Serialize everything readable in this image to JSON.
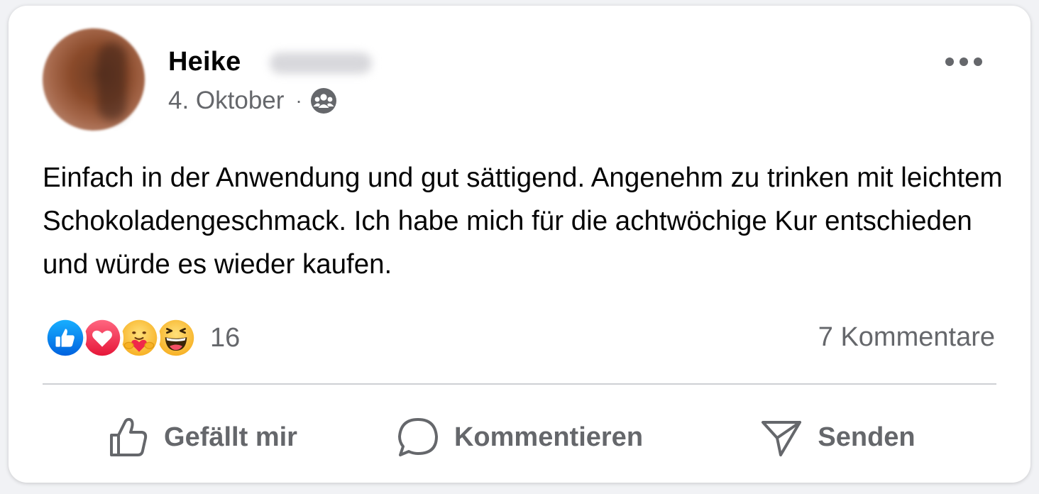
{
  "post": {
    "author_first_name": "Heike",
    "date": "4. Oktober",
    "separator": "·",
    "audience_icon": "friends-group-icon",
    "body": "Einfach in der Anwendung und gut sättigend. Angenehm zu trinken mit leichtem Schokoladengeschmack. Ich habe mich für die achtwöchige Kur entschieden und würde es wieder kaufen."
  },
  "reactions": {
    "icons": [
      "like-icon",
      "love-icon",
      "care-icon",
      "haha-icon"
    ],
    "count": "16",
    "comments_label": "7 Kommentare"
  },
  "actions": {
    "like_label": "Gefällt mir",
    "comment_label": "Kommentieren",
    "send_label": "Senden"
  },
  "colors": {
    "like_blue": "#1877f2",
    "love_red": "#f33e58",
    "secondary_text": "#65676b",
    "primary_text": "#050505"
  }
}
